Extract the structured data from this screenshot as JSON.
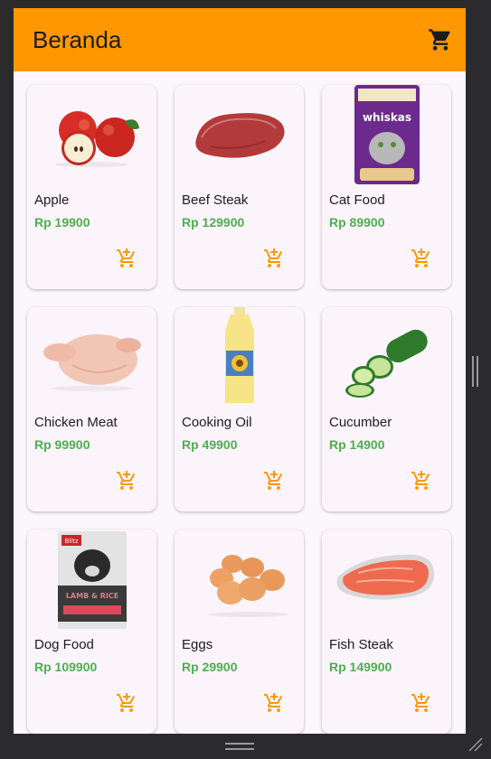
{
  "appbar": {
    "title": "Beranda",
    "cart_icon": "shopping-cart-icon"
  },
  "accent_colors": {
    "appbar": "#ff9800",
    "price": "#4caf50",
    "add_icon": "#ff9800"
  },
  "products": [
    {
      "name": "Apple",
      "price": "Rp 19900"
    },
    {
      "name": "Beef Steak",
      "price": "Rp 129900"
    },
    {
      "name": "Cat Food",
      "price": "Rp 89900"
    },
    {
      "name": "Chicken Meat",
      "price": "Rp 99900"
    },
    {
      "name": "Cooking Oil",
      "price": "Rp 49900"
    },
    {
      "name": "Cucumber",
      "price": "Rp 14900"
    },
    {
      "name": "Dog Food",
      "price": "Rp 109900"
    },
    {
      "name": "Eggs",
      "price": "Rp 29900"
    },
    {
      "name": "Fish Steak",
      "price": "Rp 149900"
    }
  ],
  "product_brand_text": {
    "cat_food": "whiskas",
    "dog_food_brand": "Blitz",
    "dog_food_flavor": "LAMB & RICE"
  }
}
